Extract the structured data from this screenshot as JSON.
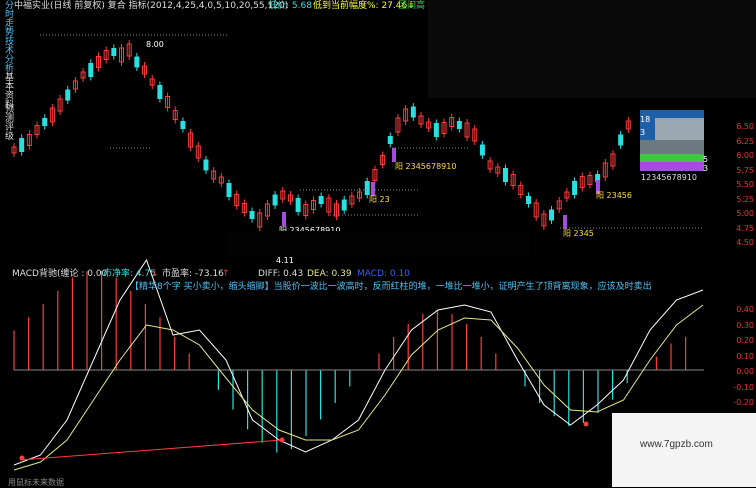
{
  "header": {
    "stock": "中福实业(日线 前复权) 复合 指标(2012,4,25,4,0,5,10,20,55,120)",
    "price_label": "低价: 5.68",
    "drop_label": "低到当前幅度%: 27.46↓",
    "range_label": "区间高"
  },
  "side_tabs": [
    "分时走势",
    "技术分析",
    "基本资料",
    "预测评级"
  ],
  "price_labels": {
    "high": "8.00",
    "low": "4.11",
    "yang1": "阳 2345678910",
    "yang2": "阳 23",
    "yang3": "阳 2345678910",
    "yang4": "阳 2345",
    "yang5": "阳 23456",
    "seq_right": "12345678910",
    "box_num_a": "18",
    "box_num_b": "3",
    "box_num_c": "5",
    "box_num_d": "3"
  },
  "price_axis": [
    "6.50",
    "6.25",
    "6.00",
    "5.75",
    "5.50",
    "5.25",
    "5.00",
    "4.75",
    "4.50"
  ],
  "macd": {
    "name": "MACD背驰(缠论 : 0.00",
    "jz_label": "市净率: 4.75",
    "jz_arrow": "↓",
    "ying_label": "市盈率: -73.16",
    "ying_arrow": "↑",
    "diff_label": "DIFF: 0.43",
    "dea_label": "DEA: 0.39",
    "macd_label": "MACD: 0.10",
    "note": "【精华8个字 买小卖小，缩头缩脚】当股价一波比一波高时，反而红柱的堆，一堆比一堆小，证明产生了顶背离现象，应该及时卖出"
  },
  "macd_axis": [
    "0.40",
    "0.30",
    "0.20",
    "0.10",
    "0.00",
    "-0.10",
    "-0.20"
  ],
  "footer": "用鼠标未来数据",
  "watermark": "www.7gpzb.com",
  "colors": {
    "up": "#ff3b3b",
    "down": "#28e0e0",
    "diff": "#ffffff",
    "dea": "#e6e68a",
    "accent": "#4fc3f7",
    "yellow": "#ffff33",
    "purple": "#a24de0"
  },
  "chart_data": {
    "type": "bar",
    "title": "MACD",
    "x": [],
    "series": [
      {
        "name": "MACD",
        "values": [
          0.12,
          0.16,
          0.2,
          0.24,
          0.28,
          0.3,
          0.3,
          0.28,
          0.24,
          0.2,
          0.16,
          0.1,
          0.05,
          0.0,
          -0.06,
          -0.12,
          -0.18,
          -0.22,
          -0.25,
          -0.24,
          -0.2,
          -0.15,
          -0.1,
          -0.05,
          0.0,
          0.05,
          0.1,
          0.14,
          0.17,
          0.18,
          0.17,
          0.14,
          0.1,
          0.05,
          0.0,
          -0.05,
          -0.1,
          -0.14,
          -0.17,
          -0.16,
          -0.13,
          -0.09,
          -0.04,
          0.0,
          0.04,
          0.08,
          0.1
        ]
      }
    ]
  }
}
